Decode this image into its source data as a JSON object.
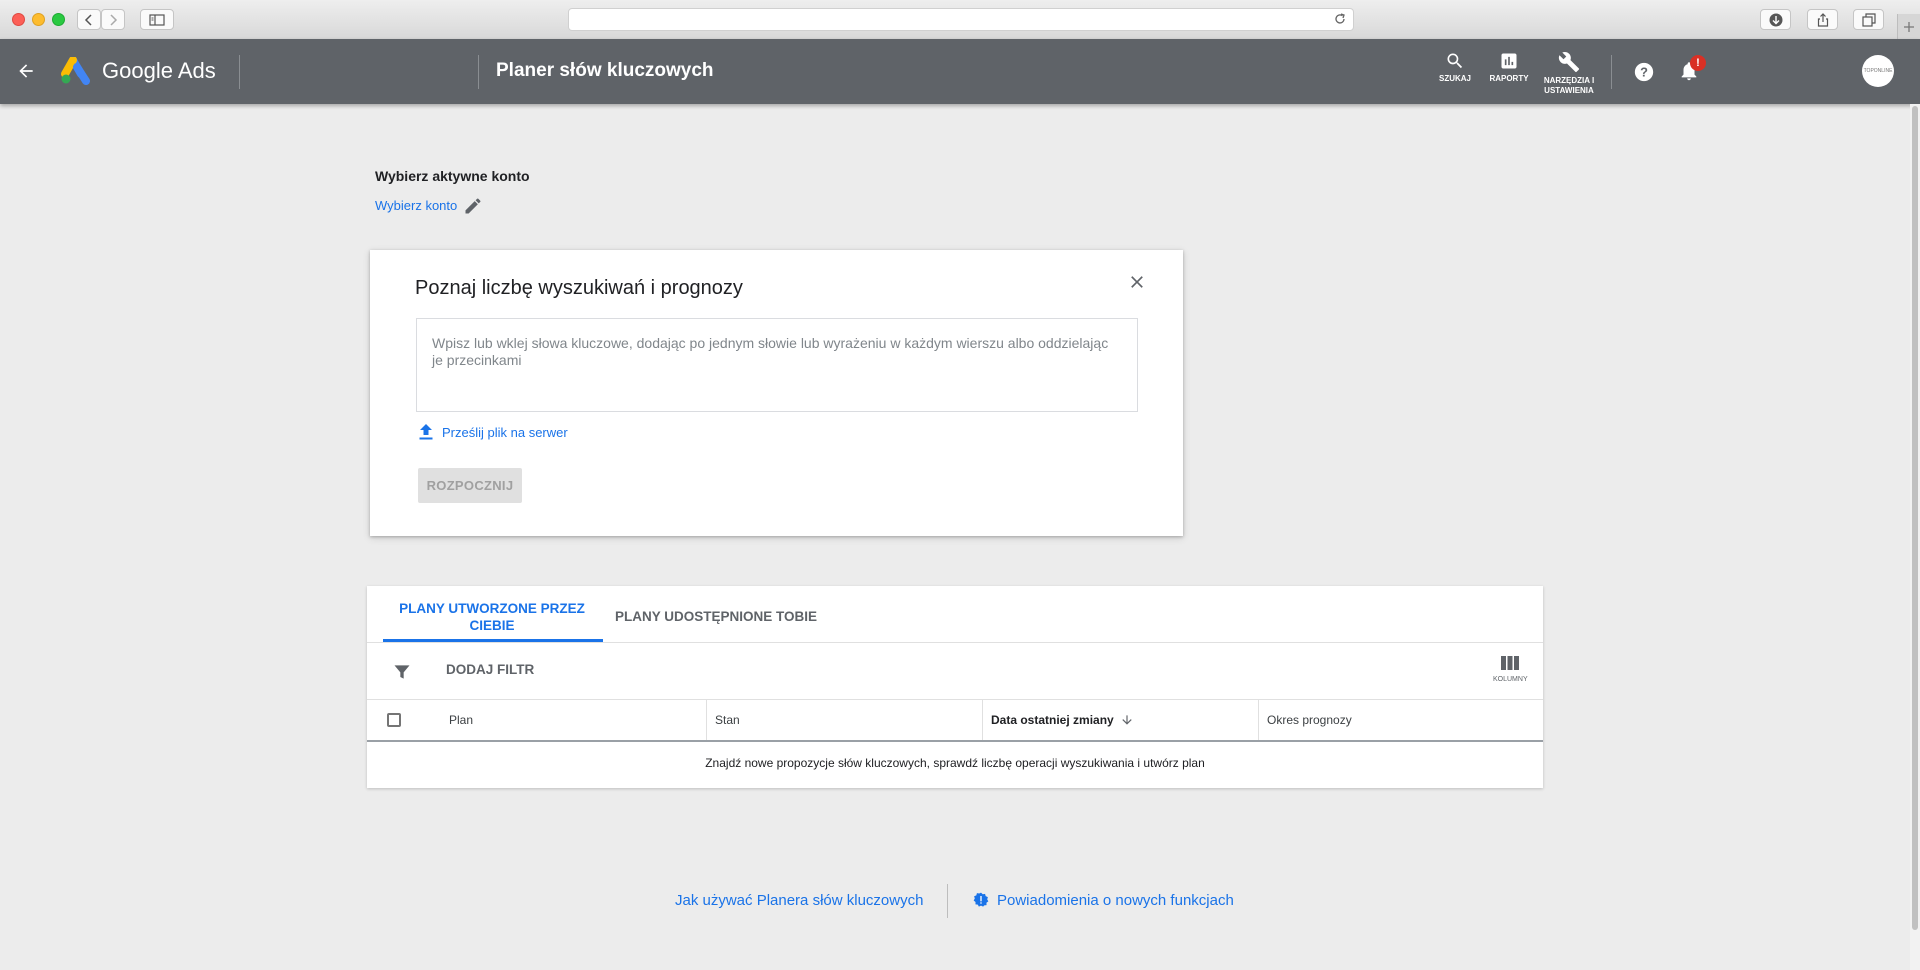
{
  "app": {
    "brand": "Google Ads",
    "page_title": "Planer słów kluczowych",
    "actions": [
      {
        "label": "SZUKAJ"
      },
      {
        "label": "RAPORTY"
      },
      {
        "label": "NARZĘDZIA I USTAWIENIA"
      }
    ],
    "notification_badge": "!",
    "avatar_text": "TOPONLINE",
    "accent_color": "#1a73e8",
    "header_color": "#5f6368"
  },
  "account": {
    "title": "Wybierz aktywne konto",
    "link": "Wybierz konto"
  },
  "search_card": {
    "title": "Poznaj liczbę wyszukiwań i prognozy",
    "keywords_placeholder": "Wpisz lub wklej słowa kluczowe, dodając po jednym słowie lub wyrażeniu w każdym wierszu albo oddzielając je przecinkami",
    "upload_label": "Prześlij plik na serwer",
    "start_label": "ROZPOCZNIJ"
  },
  "plans": {
    "tabs": [
      {
        "label": "PLANY UTWORZONE PRZEZ CIEBIE",
        "active": true
      },
      {
        "label": "PLANY UDOSTĘPNIONE TOBIE",
        "active": false
      }
    ],
    "add_filter_label": "DODAJ FILTR",
    "columns_label": "KOLUMNY",
    "headers": [
      "Plan",
      "Stan",
      "Data ostatniej zmiany",
      "Okres prognozy"
    ],
    "empty_message": "Znajdź nowe propozycje słów kluczowych, sprawdź liczbę operacji wyszukiwania i utwórz plan"
  },
  "footer": {
    "help_link": "Jak używać Planera słów kluczowych",
    "news_link": "Powiadomienia o nowych funkcjach"
  }
}
